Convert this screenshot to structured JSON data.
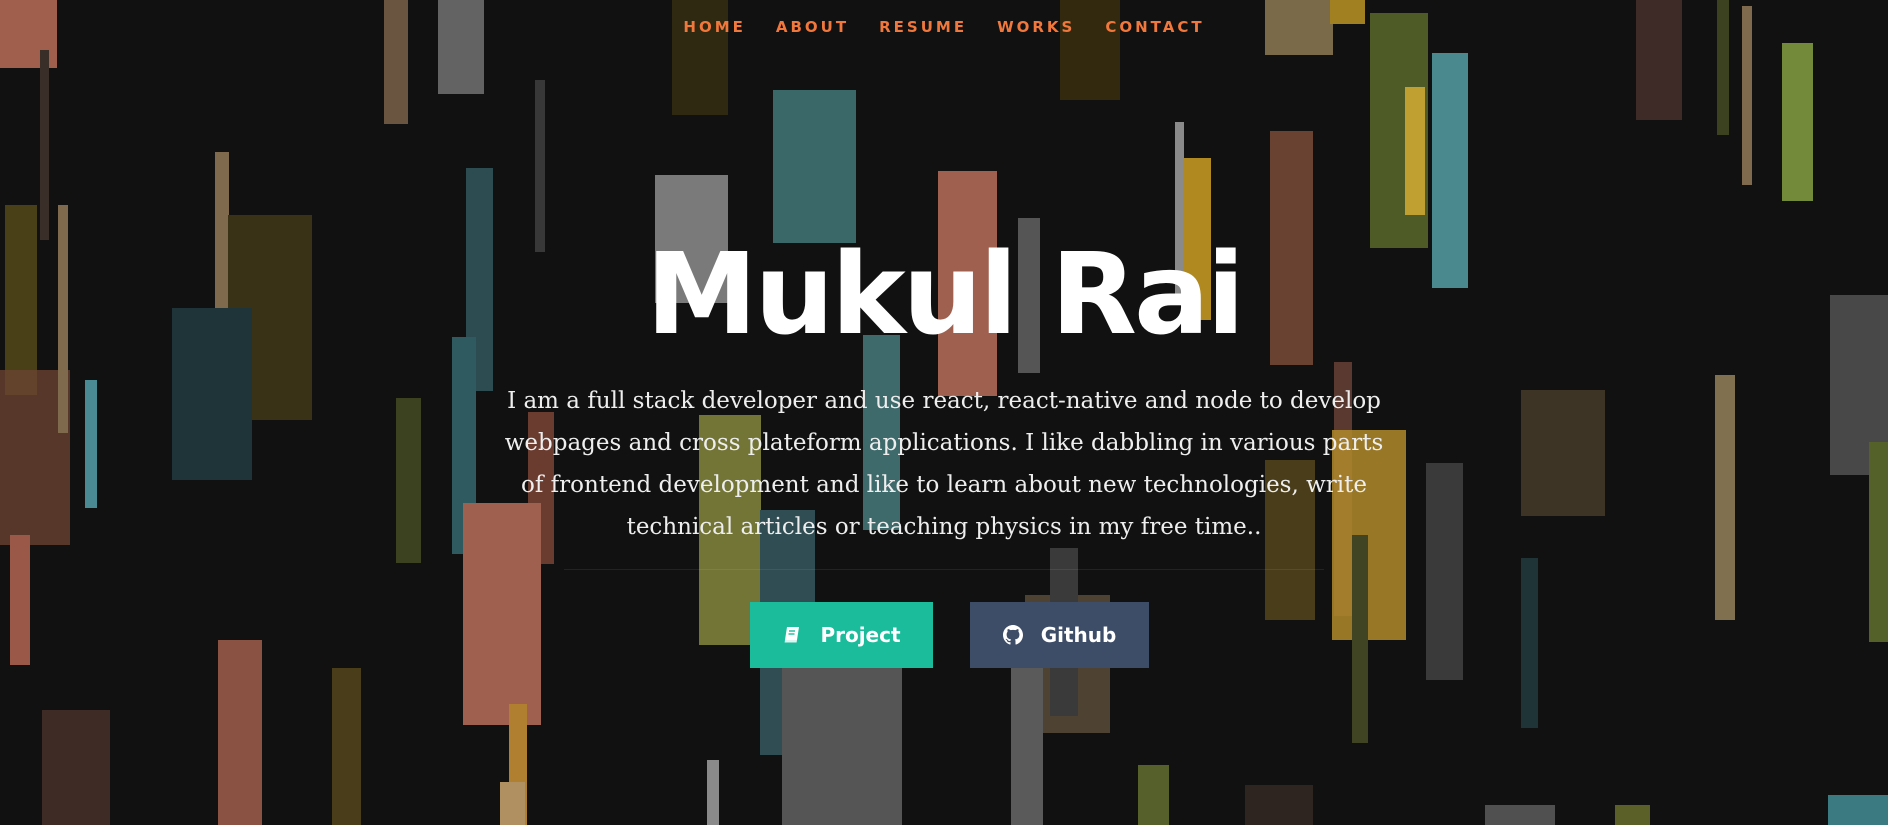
{
  "nav": {
    "items": [
      {
        "label": "HOME",
        "name": "nav-home"
      },
      {
        "label": "ABOUT",
        "name": "nav-about"
      },
      {
        "label": "RESUME",
        "name": "nav-resume"
      },
      {
        "label": "WORKS",
        "name": "nav-works"
      },
      {
        "label": "CONTACT",
        "name": "nav-contact"
      }
    ],
    "color": "#f0783c"
  },
  "hero": {
    "name": "Mukul Rai",
    "description": "I am a full stack developer and use react, react-native and node to develop webpages and cross plateform applications. I like dabbling in various parts of frontend development and like to learn about new technologies, write technical articles or teaching physics in my free time.."
  },
  "buttons": {
    "project": {
      "label": "Project",
      "icon": "book-icon",
      "color": "#1abc9c"
    },
    "github": {
      "label": "Github",
      "icon": "github-icon",
      "color": "#3d4d67"
    }
  },
  "colors": {
    "background": "#111111"
  }
}
